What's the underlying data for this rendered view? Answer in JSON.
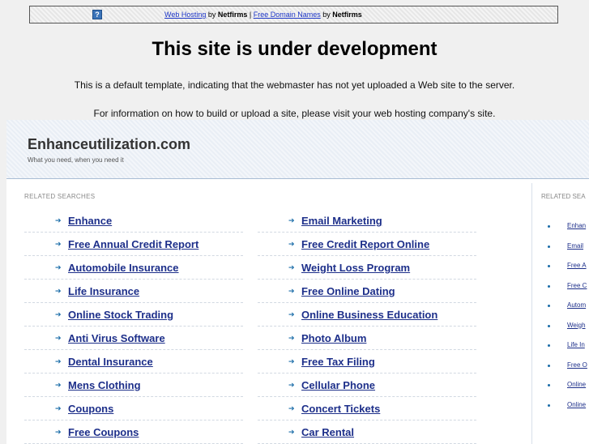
{
  "banner": {
    "icon": "question-icon",
    "link1": "Web Hosting",
    "by1": " by ",
    "brand1": "Netfirms",
    "sep": " | ",
    "link2": "Free Domain Names",
    "by2": " by ",
    "brand2": "Netfirms"
  },
  "headline": "This site is under development",
  "line1": "This is a default template, indicating that the webmaster has not yet uploaded a Web site to the server.",
  "line2": "For information on how to build or upload a site, please visit your web hosting company's site.",
  "panel": {
    "site_name": "Enhanceutilization.com",
    "tagline": "What you need, when you need it",
    "related_label": "RELATED SEARCHES",
    "left_items": [
      "Enhance",
      "Free Annual Credit Report",
      "Automobile Insurance",
      "Life Insurance",
      "Online Stock Trading",
      "Anti Virus Software",
      "Dental Insurance",
      "Mens Clothing",
      "Coupons",
      "Free Coupons"
    ],
    "right_items": [
      "Email Marketing",
      "Free Credit Report Online",
      "Weight Loss Program",
      "Free Online Dating",
      "Online Business Education",
      "Photo Album",
      "Free Tax Filing",
      "Cellular Phone",
      "Concert Tickets",
      "Car Rental"
    ],
    "side_label": "RELATED SEA",
    "side_items": [
      "Enhan",
      "Email",
      "Free A",
      "Free C",
      "Autom",
      "Weigh",
      "Life In",
      "Free O",
      "Online",
      "Online"
    ]
  },
  "colors": {
    "link": "#1d2f8a",
    "arrow": "#1a6ca8",
    "banner_link": "#1d36c7"
  }
}
